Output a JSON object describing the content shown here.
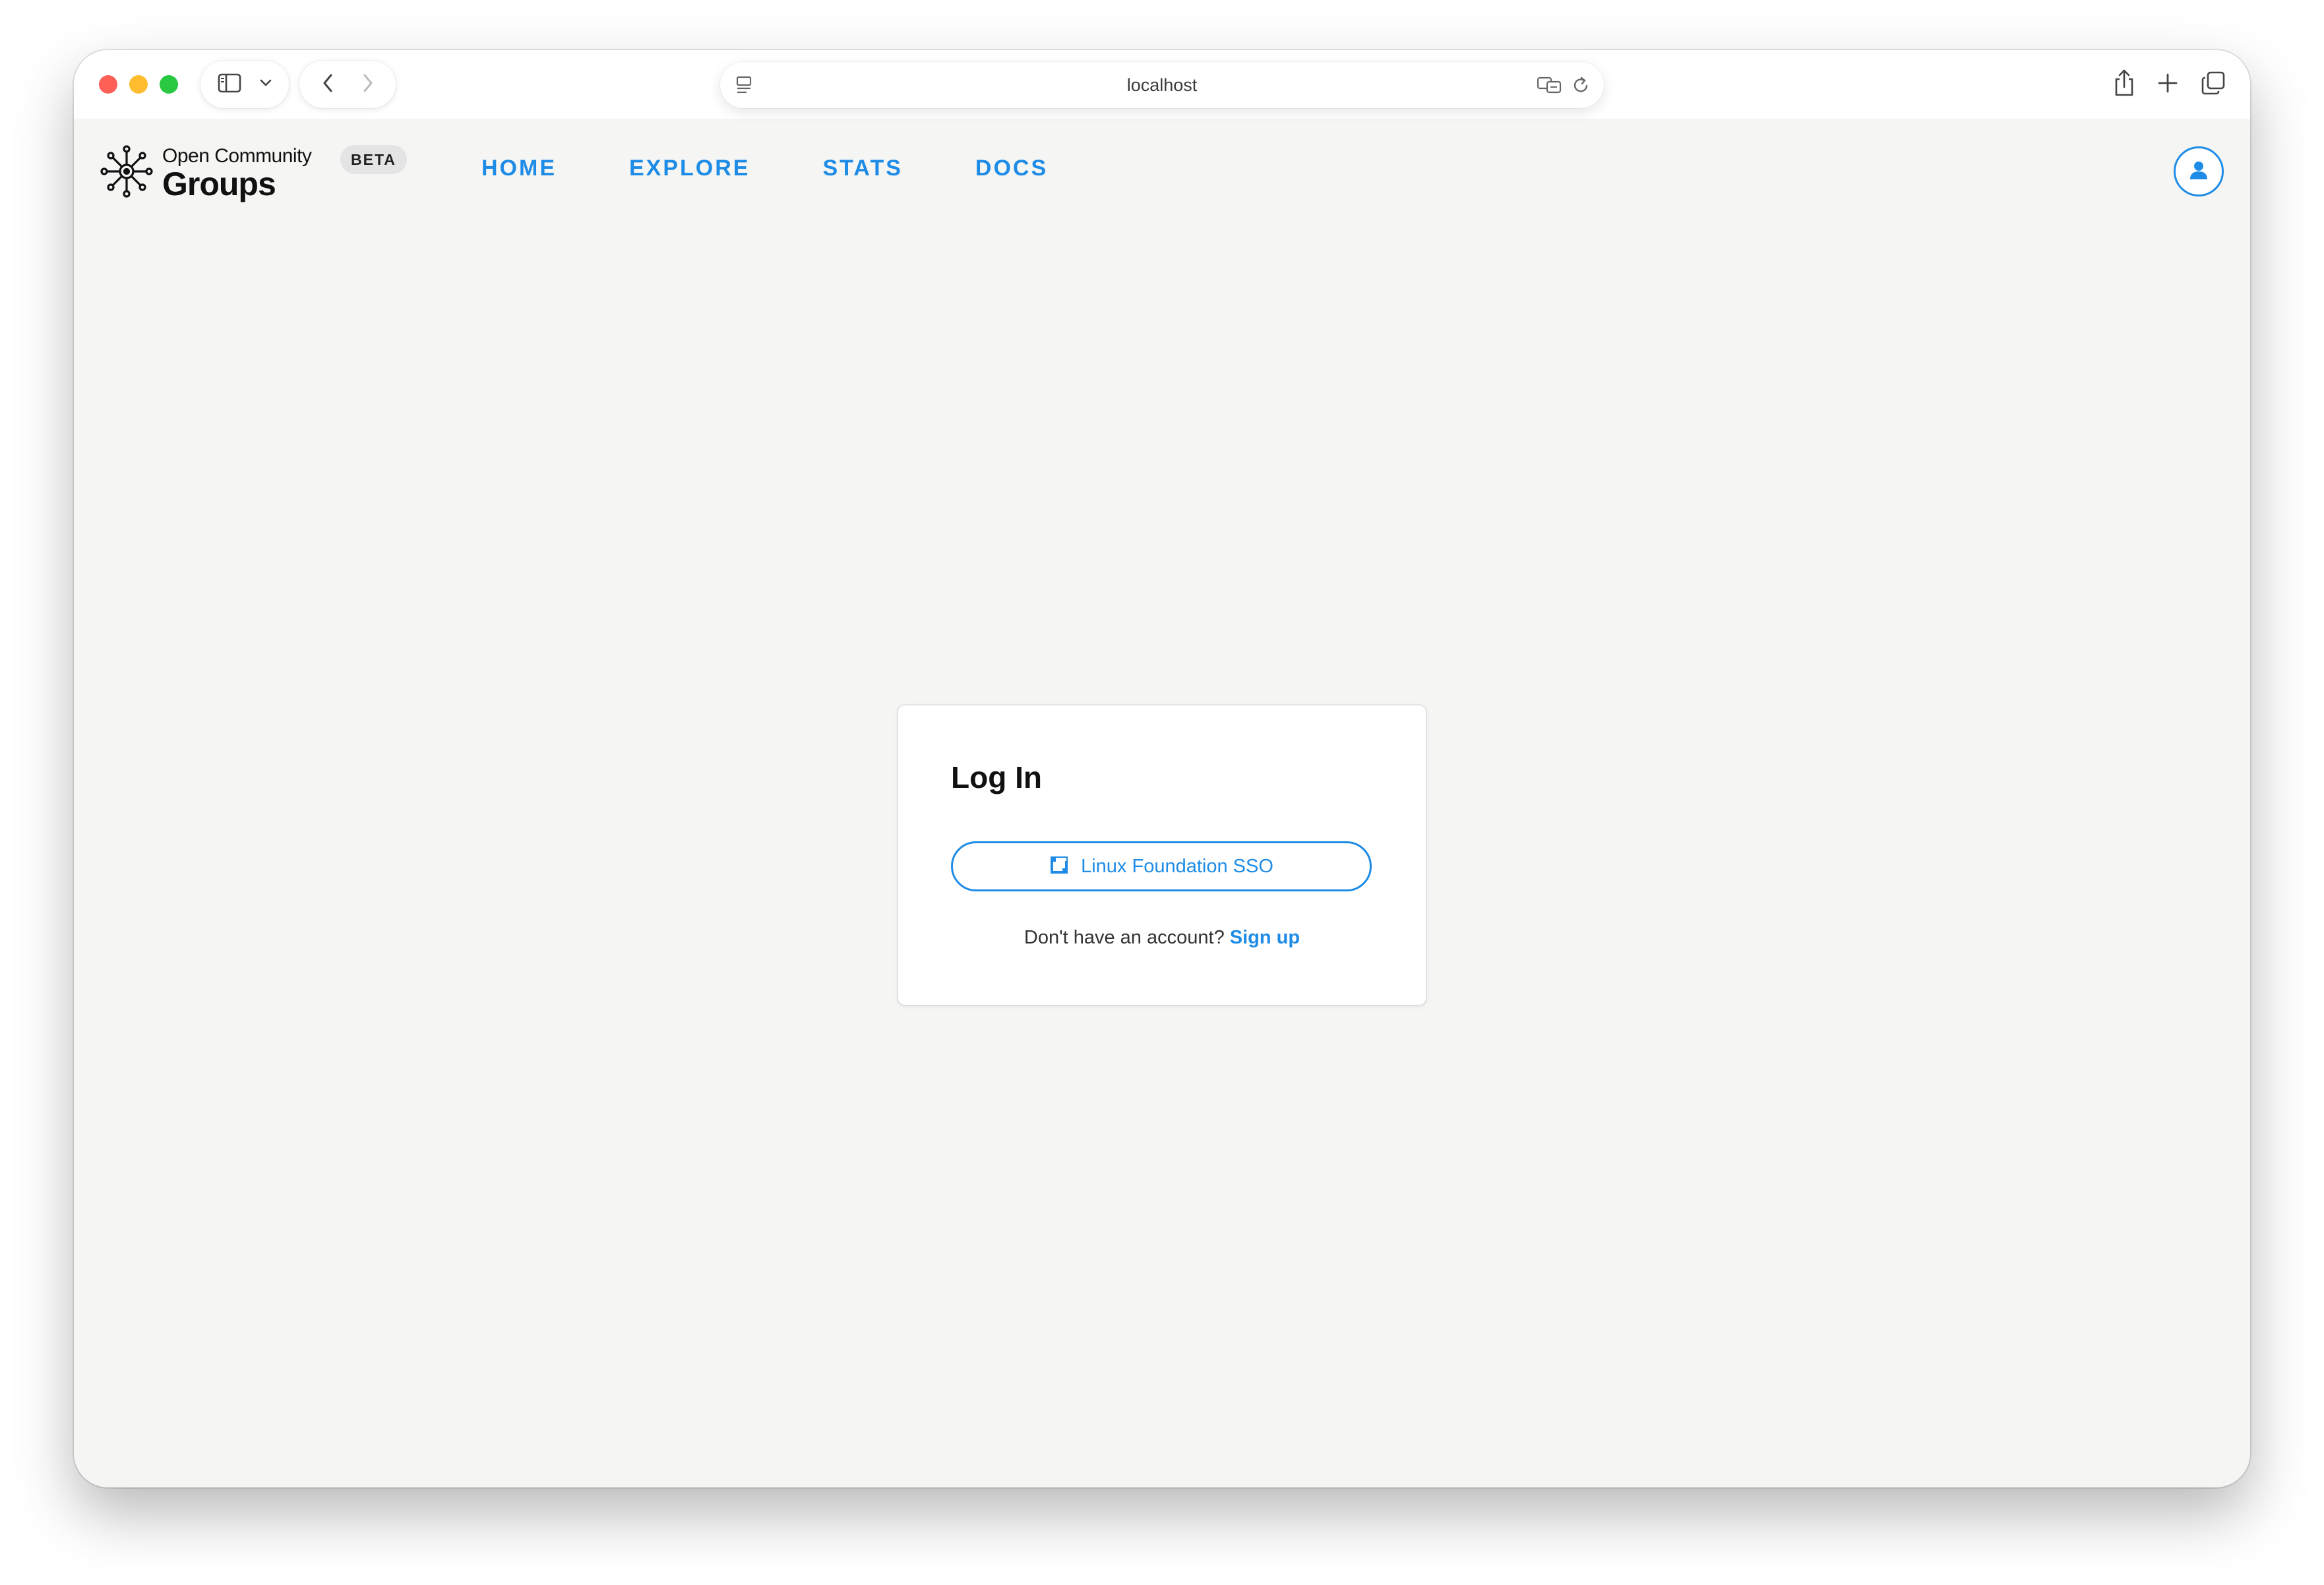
{
  "browser": {
    "url": "localhost"
  },
  "site": {
    "logo_line1": "Open Community",
    "logo_line2": "Groups",
    "badge": "BETA",
    "nav": [
      {
        "label": "HOME"
      },
      {
        "label": "EXPLORE"
      },
      {
        "label": "STATS"
      },
      {
        "label": "DOCS"
      }
    ]
  },
  "login": {
    "title": "Log In",
    "sso_label": "Linux Foundation SSO",
    "signup_prompt": "Don't have an account?",
    "signup_link": "Sign up"
  },
  "colors": {
    "accent": "#1e8ce6",
    "page_bg": "#f5f5f4",
    "card_bg": "#ffffff"
  },
  "icons": {
    "sidebar": "sidebar-icon",
    "user": "user-icon",
    "sso": "linux-foundation-icon"
  }
}
